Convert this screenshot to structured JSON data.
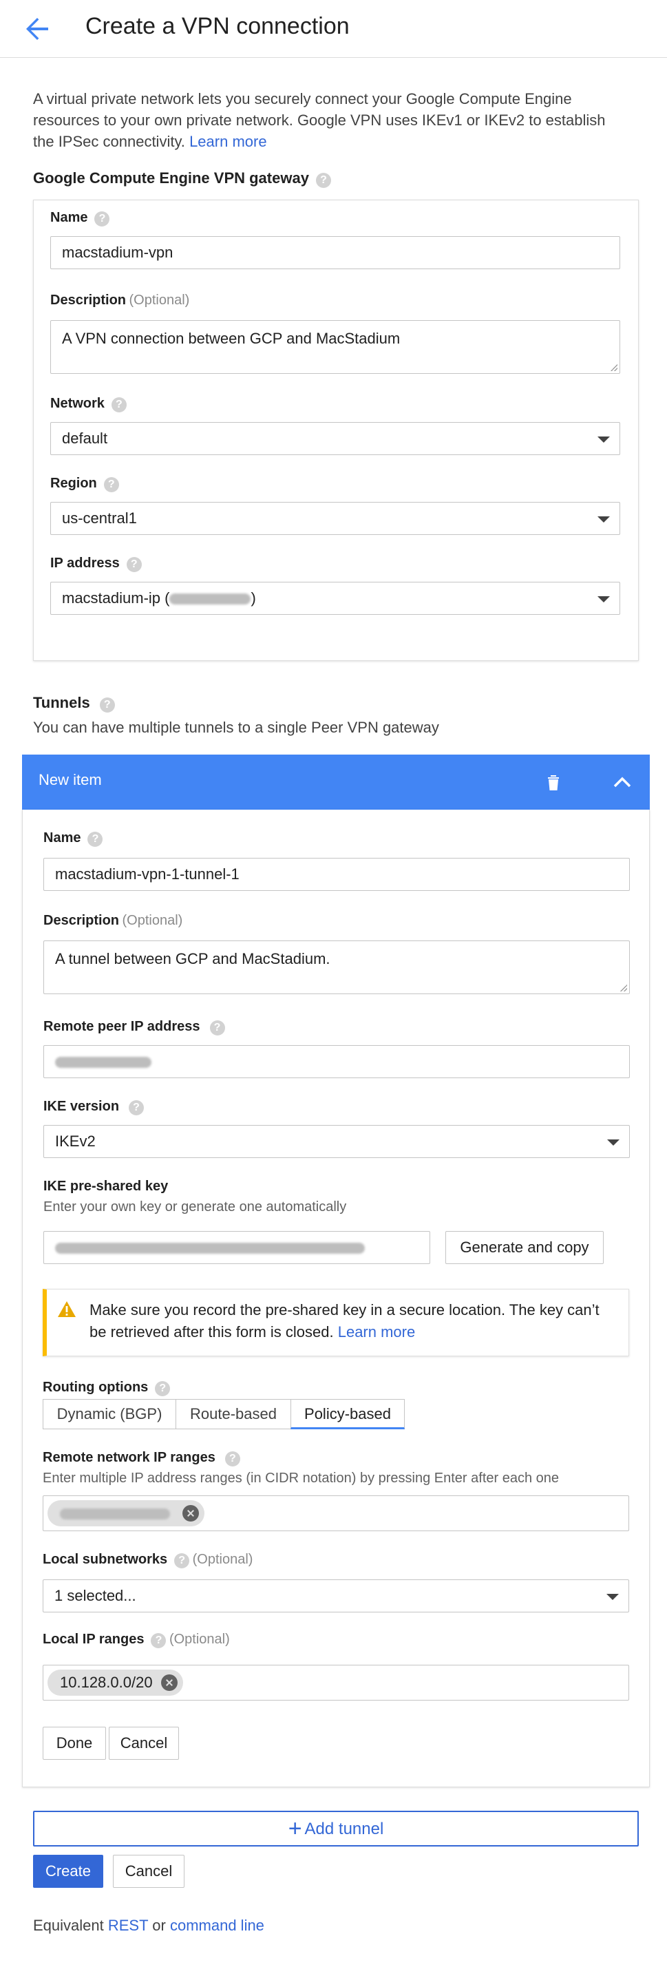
{
  "header": {
    "title": "Create a VPN connection",
    "back_icon": "arrow-back-icon"
  },
  "intro": {
    "text": "A virtual private network lets you securely connect your Google Compute Engine resources to your own private network. Google VPN uses IKEv1 or IKEv2 to establish the IPSec connectivity.",
    "learn_more": "Learn more"
  },
  "gateway": {
    "title": "Google Compute Engine VPN gateway",
    "name_label": "Name",
    "name_value": "macstadium-vpn",
    "description_label": "Description",
    "description_optional": "(Optional)",
    "description_value": "A VPN connection between GCP and MacStadium",
    "network_label": "Network",
    "network_value": "default",
    "region_label": "Region",
    "region_value": "us-central1",
    "ip_label": "IP address",
    "ip_value_prefix": "macstadium-ip (",
    "ip_value_suffix": ")"
  },
  "tunnels": {
    "title": "Tunnels",
    "subtitle": "You can have multiple tunnels to a single Peer VPN gateway",
    "item": {
      "header_title": "New item",
      "name_label": "Name",
      "name_value": "macstadium-vpn-1-tunnel-1",
      "description_label": "Description",
      "description_optional": "(Optional)",
      "description_value": "A tunnel between GCP and MacStadium.",
      "remote_peer_label": "Remote peer IP address",
      "ike_version_label": "IKE version",
      "ike_version_value": "IKEv2",
      "ike_key_label": "IKE pre-shared key",
      "ike_key_help": "Enter your own key or generate one automatically",
      "generate_button": "Generate and copy",
      "warning_text": "Make sure you record the pre-shared key in a secure location. The key can’t be retrieved after this form is closed.",
      "warning_link": "Learn more",
      "routing_label": "Routing options",
      "routing_options": [
        "Dynamic (BGP)",
        "Route-based",
        "Policy-based"
      ],
      "routing_selected": "Policy-based",
      "remote_ranges_label": "Remote network IP ranges",
      "remote_ranges_help": "Enter multiple IP address ranges (in CIDR notation) by pressing Enter after each one",
      "local_subnets_label": "Local subnetworks",
      "local_subnets_optional": "(Optional)",
      "local_subnets_value": "1 selected...",
      "local_ip_label": "Local IP ranges",
      "local_ip_optional": "(Optional)",
      "local_ip_chip": "10.128.0.0/20",
      "done_button": "Done",
      "cancel_button": "Cancel"
    }
  },
  "actions": {
    "add_tunnel": "Add tunnel",
    "create": "Create",
    "cancel": "Cancel"
  },
  "footer": {
    "prefix": "Equivalent",
    "rest": "REST",
    "or": "or",
    "command_line": "command line"
  },
  "colors": {
    "accent": "#3367d6",
    "item_header": "#4285f4",
    "warning": "#fbbc04"
  }
}
